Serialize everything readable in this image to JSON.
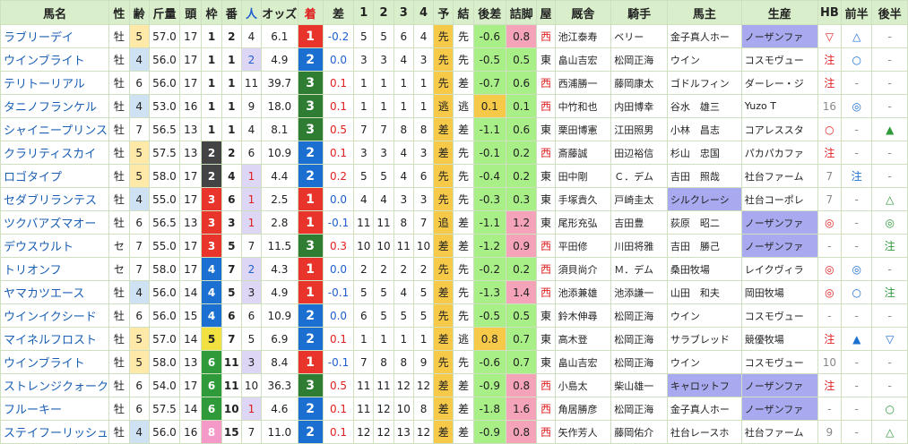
{
  "headers": [
    "馬名",
    "性",
    "齢",
    "斤量",
    "頭",
    "枠",
    "番",
    "人",
    "オッズ",
    "着",
    "差",
    "1",
    "2",
    "3",
    "4",
    "予",
    "結",
    "後差",
    "詰脚",
    "屋",
    "厩舎",
    "騎手",
    "馬主",
    "生産",
    "HB",
    "前半",
    "後半"
  ],
  "colors": {
    "header_bg": "#d9eecb",
    "age5_bg": "#ffe9a8",
    "age4_bg": "#cfe2f3",
    "pop_bg": "#ddd6f5",
    "yoso_bg": "#f7c948",
    "rank_colors": {
      "1": "#e8342b",
      "2": "#1a6fd1",
      "3": "#2f7d32"
    },
    "frame_colors": {
      "1": "#ffffff",
      "2": "#444444",
      "3": "#e8342b",
      "4": "#1a6fd1",
      "5": "#f0e040",
      "6": "#2e9a3a",
      "7": "#f59a2c",
      "8": "#f59ac8"
    },
    "owner_hl": "#a9a9f0",
    "breeder_hl": "#a9a9f0",
    "late_low": "#f5a3b8",
    "late_high": "#a7ef86",
    "gosa_neg": "#a7ef86",
    "gosa_pos": "#f7c948"
  },
  "rows": [
    {
      "name": "ラブリーデイ",
      "sex": "牡",
      "age": "5",
      "kin": "57.0",
      "to": "17",
      "waku": "1",
      "ban": "2",
      "nin": "4",
      "odds": "6.1",
      "chaku": "1",
      "sa": "-0.2",
      "c1": "5",
      "c2": "5",
      "c3": "6",
      "c4": "4",
      "yoso": "先",
      "ketsu": "先",
      "gosa": "-0.6",
      "tsume": "0.8",
      "ya": "西",
      "kyu": "池江泰寿",
      "kishu": "ベリー",
      "banu": "金子真人ホー",
      "seisan": "ノーザンファ",
      "hb": "▽",
      "zen": "△",
      "kou": "-"
    },
    {
      "name": "ウインブライト",
      "sex": "牡",
      "age": "4",
      "kin": "56.0",
      "to": "17",
      "waku": "1",
      "ban": "1",
      "nin": "2",
      "odds": "4.9",
      "chaku": "2",
      "sa": "0.0",
      "c1": "3",
      "c2": "3",
      "c3": "4",
      "c4": "3",
      "yoso": "先",
      "ketsu": "先",
      "gosa": "-0.5",
      "tsume": "0.5",
      "ya": "東",
      "kyu": "畠山吉宏",
      "kishu": "松岡正海",
      "banu": "ウイン",
      "seisan": "コスモヴュー",
      "hb": "注",
      "zen": "○",
      "kou": "-"
    },
    {
      "name": "テリトーリアル",
      "sex": "牡",
      "age": "6",
      "kin": "56.0",
      "to": "17",
      "waku": "1",
      "ban": "1",
      "nin": "11",
      "odds": "39.7",
      "chaku": "3",
      "sa": "0.1",
      "c1": "1",
      "c2": "1",
      "c3": "1",
      "c4": "1",
      "yoso": "先",
      "ketsu": "差",
      "gosa": "-0.7",
      "tsume": "0.6",
      "ya": "西",
      "kyu": "西浦勝一",
      "kishu": "藤岡康太",
      "banu": "ゴドルフィン",
      "seisan": "ダーレー・ジ",
      "hb": "注",
      "zen": "-",
      "kou": "-"
    },
    {
      "name": "タニノフランケル",
      "sex": "牡",
      "age": "4",
      "kin": "53.0",
      "to": "16",
      "waku": "1",
      "ban": "1",
      "nin": "9",
      "odds": "18.0",
      "chaku": "3",
      "sa": "0.1",
      "c1": "1",
      "c2": "1",
      "c3": "1",
      "c4": "1",
      "yoso": "逃",
      "ketsu": "逃",
      "gosa": "0.1",
      "tsume": "0.1",
      "ya": "西",
      "kyu": "中竹和也",
      "kishu": "内田博幸",
      "banu": "谷水　雄三",
      "seisan": "Yuzo T",
      "hb": "16",
      "zen": "◎",
      "kou": "-"
    },
    {
      "name": "シャイニープリンス",
      "sex": "牡",
      "age": "7",
      "kin": "56.5",
      "to": "13",
      "waku": "1",
      "ban": "1",
      "nin": "4",
      "odds": "8.1",
      "chaku": "3",
      "sa": "0.5",
      "c1": "7",
      "c2": "7",
      "c3": "8",
      "c4": "8",
      "yoso": "差",
      "ketsu": "差",
      "gosa": "-1.1",
      "tsume": "0.6",
      "ya": "東",
      "kyu": "栗田博憲",
      "kishu": "江田照男",
      "banu": "小林　昌志",
      "seisan": "コアレススタ",
      "hb": "○",
      "zen": "-",
      "kou": "▲"
    },
    {
      "name": "クラリティスカイ",
      "sex": "牡",
      "age": "5",
      "kin": "57.5",
      "to": "13",
      "waku": "2",
      "ban": "2",
      "nin": "6",
      "odds": "10.9",
      "chaku": "2",
      "sa": "0.1",
      "c1": "3",
      "c2": "3",
      "c3": "4",
      "c4": "3",
      "yoso": "差",
      "ketsu": "先",
      "gosa": "-0.1",
      "tsume": "0.2",
      "ya": "西",
      "kyu": "斎藤誠",
      "kishu": "田辺裕信",
      "banu": "杉山　忠国",
      "seisan": "パカパカファ",
      "hb": "注",
      "zen": "-",
      "kou": "-"
    },
    {
      "name": "ロゴタイプ",
      "sex": "牡",
      "age": "5",
      "kin": "58.0",
      "to": "17",
      "waku": "2",
      "ban": "4",
      "nin": "1",
      "odds": "4.4",
      "chaku": "2",
      "sa": "0.2",
      "c1": "5",
      "c2": "5",
      "c3": "4",
      "c4": "6",
      "yoso": "先",
      "ketsu": "先",
      "gosa": "-0.4",
      "tsume": "0.2",
      "ya": "東",
      "kyu": "田中剛",
      "kishu": "Ｃ．デム",
      "banu": "吉田　照哉",
      "seisan": "社台ファーム",
      "hb": "7",
      "zen": "注",
      "kou": "-"
    },
    {
      "name": "セダブリランテス",
      "sex": "牡",
      "age": "4",
      "kin": "55.0",
      "to": "17",
      "waku": "3",
      "ban": "6",
      "nin": "1",
      "odds": "2.5",
      "chaku": "1",
      "sa": "0.0",
      "c1": "4",
      "c2": "4",
      "c3": "3",
      "c4": "3",
      "yoso": "先",
      "ketsu": "先",
      "gosa": "-0.3",
      "tsume": "0.3",
      "ya": "東",
      "kyu": "手塚貴久",
      "kishu": "戸崎圭太",
      "banu": "シルクレーシ",
      "seisan": "社台コーポレ",
      "hb": "7",
      "zen": "-",
      "kou": "△"
    },
    {
      "name": "ツクバアズマオー",
      "sex": "牡",
      "age": "6",
      "kin": "56.5",
      "to": "13",
      "waku": "3",
      "ban": "3",
      "nin": "1",
      "odds": "2.8",
      "chaku": "1",
      "sa": "-0.1",
      "c1": "11",
      "c2": "11",
      "c3": "8",
      "c4": "7",
      "yoso": "追",
      "ketsu": "差",
      "gosa": "-1.1",
      "tsume": "1.2",
      "ya": "東",
      "kyu": "尾形充弘",
      "kishu": "吉田豊",
      "banu": "荻原　昭二",
      "seisan": "ノーザンファ",
      "hb": "◎",
      "zen": "-",
      "kou": "◎"
    },
    {
      "name": "デウスウルト",
      "sex": "セ",
      "age": "7",
      "kin": "55.0",
      "to": "17",
      "waku": "3",
      "ban": "5",
      "nin": "7",
      "odds": "11.5",
      "chaku": "3",
      "sa": "0.3",
      "c1": "10",
      "c2": "10",
      "c3": "11",
      "c4": "10",
      "yoso": "差",
      "ketsu": "差",
      "gosa": "-1.2",
      "tsume": "0.9",
      "ya": "西",
      "kyu": "平田修",
      "kishu": "川田将雅",
      "banu": "吉田　勝己",
      "seisan": "ノーザンファ",
      "hb": "-",
      "zen": "-",
      "kou": "注"
    },
    {
      "name": "トリオンフ",
      "sex": "セ",
      "age": "7",
      "kin": "58.0",
      "to": "17",
      "waku": "4",
      "ban": "7",
      "nin": "2",
      "odds": "4.3",
      "chaku": "1",
      "sa": "0.0",
      "c1": "2",
      "c2": "2",
      "c3": "2",
      "c4": "2",
      "yoso": "先",
      "ketsu": "先",
      "gosa": "-0.2",
      "tsume": "0.2",
      "ya": "西",
      "kyu": "須貝尚介",
      "kishu": "Ｍ．デム",
      "banu": "桑田牧場",
      "seisan": "レイクヴィラ",
      "hb": "◎",
      "zen": "◎",
      "kou": "-"
    },
    {
      "name": "ヤマカツエース",
      "sex": "牡",
      "age": "4",
      "kin": "56.0",
      "to": "14",
      "waku": "4",
      "ban": "5",
      "nin": "3",
      "odds": "4.9",
      "chaku": "1",
      "sa": "-0.1",
      "c1": "5",
      "c2": "5",
      "c3": "4",
      "c4": "5",
      "yoso": "差",
      "ketsu": "先",
      "gosa": "-1.3",
      "tsume": "1.4",
      "ya": "西",
      "kyu": "池添兼雄",
      "kishu": "池添謙一",
      "banu": "山田　和夫",
      "seisan": "岡田牧場",
      "hb": "◎",
      "zen": "○",
      "kou": "注"
    },
    {
      "name": "ウインイクシード",
      "sex": "牡",
      "age": "6",
      "kin": "56.0",
      "to": "15",
      "waku": "4",
      "ban": "6",
      "nin": "6",
      "odds": "10.9",
      "chaku": "2",
      "sa": "0.0",
      "c1": "6",
      "c2": "5",
      "c3": "5",
      "c4": "5",
      "yoso": "先",
      "ketsu": "先",
      "gosa": "-0.5",
      "tsume": "0.5",
      "ya": "東",
      "kyu": "鈴木伸尋",
      "kishu": "松岡正海",
      "banu": "ウイン",
      "seisan": "コスモヴュー",
      "hb": "-",
      "zen": "-",
      "kou": "-"
    },
    {
      "name": "マイネルフロスト",
      "sex": "牡",
      "age": "5",
      "kin": "57.0",
      "to": "14",
      "waku": "5",
      "ban": "7",
      "nin": "5",
      "odds": "6.9",
      "chaku": "2",
      "sa": "0.1",
      "c1": "1",
      "c2": "1",
      "c3": "1",
      "c4": "1",
      "yoso": "差",
      "ketsu": "逃",
      "gosa": "0.8",
      "tsume": "0.7",
      "ya": "東",
      "kyu": "高木登",
      "kishu": "松岡正海",
      "banu": "サラブレッド",
      "seisan": "競優牧場",
      "hb": "注",
      "zen": "▲",
      "kou": "▽"
    },
    {
      "name": "ウインブライト",
      "sex": "牡",
      "age": "5",
      "kin": "58.0",
      "to": "13",
      "waku": "6",
      "ban": "11",
      "nin": "3",
      "odds": "8.4",
      "chaku": "1",
      "sa": "-0.1",
      "c1": "7",
      "c2": "8",
      "c3": "8",
      "c4": "9",
      "yoso": "先",
      "ketsu": "先",
      "gosa": "-0.6",
      "tsume": "0.7",
      "ya": "東",
      "kyu": "畠山吉宏",
      "kishu": "松岡正海",
      "banu": "ウイン",
      "seisan": "コスモヴュー",
      "hb": "10",
      "zen": "-",
      "kou": "-"
    },
    {
      "name": "ストレンジクォーク",
      "sex": "牡",
      "age": "6",
      "kin": "54.0",
      "to": "17",
      "waku": "6",
      "ban": "11",
      "nin": "10",
      "odds": "36.3",
      "chaku": "3",
      "sa": "0.5",
      "c1": "11",
      "c2": "11",
      "c3": "12",
      "c4": "12",
      "yoso": "差",
      "ketsu": "差",
      "gosa": "-0.9",
      "tsume": "0.8",
      "ya": "西",
      "kyu": "小島太",
      "kishu": "柴山雄一",
      "banu": "キャロットフ",
      "seisan": "ノーザンファ",
      "hb": "注",
      "zen": "-",
      "kou": "-"
    },
    {
      "name": "フルーキー",
      "sex": "牡",
      "age": "6",
      "kin": "57.5",
      "to": "14",
      "waku": "6",
      "ban": "10",
      "nin": "1",
      "odds": "4.6",
      "chaku": "2",
      "sa": "0.1",
      "c1": "11",
      "c2": "12",
      "c3": "10",
      "c4": "8",
      "yoso": "差",
      "ketsu": "差",
      "gosa": "-1.8",
      "tsume": "1.6",
      "ya": "西",
      "kyu": "角居勝彦",
      "kishu": "松岡正海",
      "banu": "金子真人ホー",
      "seisan": "ノーザンファ",
      "hb": "-",
      "zen": "-",
      "kou": "○"
    },
    {
      "name": "ステイフーリッシュ",
      "sex": "牡",
      "age": "4",
      "kin": "56.0",
      "to": "16",
      "waku": "8",
      "ban": "15",
      "nin": "7",
      "odds": "11.0",
      "chaku": "2",
      "sa": "0.1",
      "c1": "12",
      "c2": "12",
      "c3": "13",
      "c4": "12",
      "yoso": "差",
      "ketsu": "差",
      "gosa": "-0.9",
      "tsume": "0.8",
      "ya": "西",
      "kyu": "矢作芳人",
      "kishu": "藤岡佑介",
      "banu": "社台レースホ",
      "seisan": "社台ファーム",
      "hb": "9",
      "zen": "-",
      "kou": "△"
    }
  ]
}
